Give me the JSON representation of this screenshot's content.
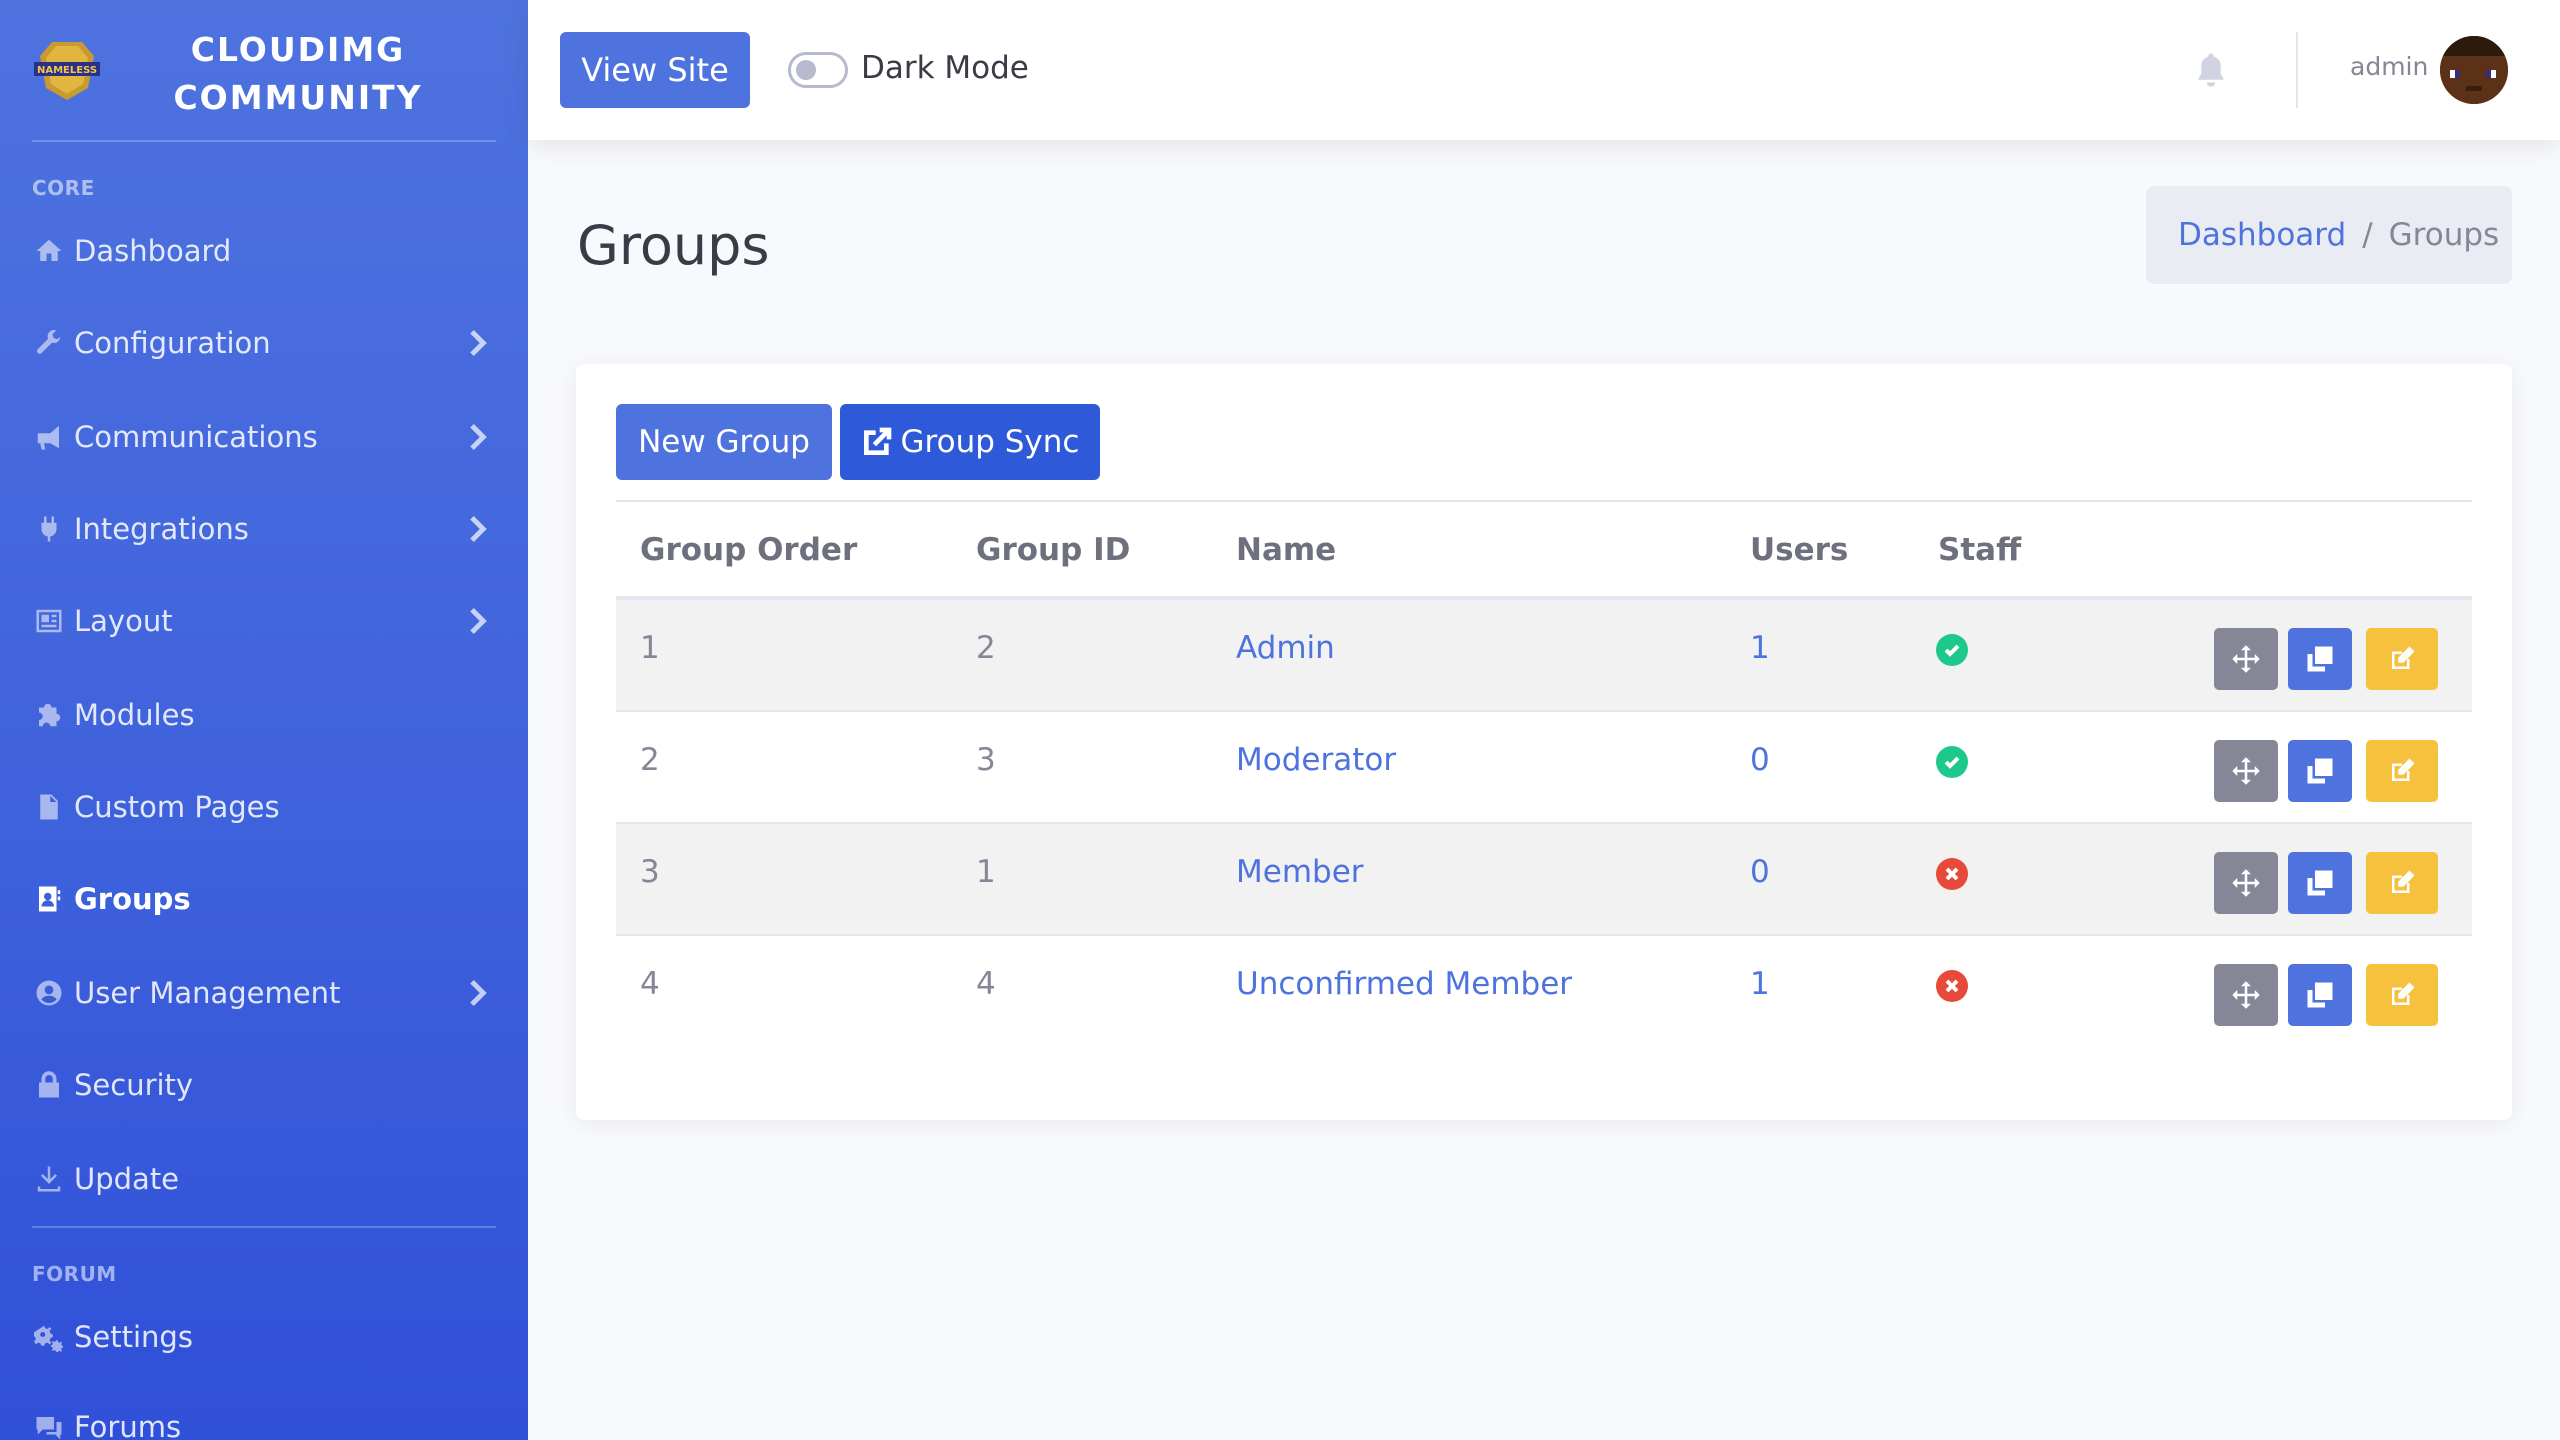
{
  "brand": {
    "name": "CLOUDIMG COMMUNITY",
    "logo_text": "NAMELESS"
  },
  "sidebar": {
    "heading_core": "CORE",
    "heading_forum": "FORUM",
    "items": [
      {
        "label": "Dashboard",
        "icon": "home-icon"
      },
      {
        "label": "Configuration",
        "icon": "wrench-icon"
      },
      {
        "label": "Communications",
        "icon": "bullhorn-icon"
      },
      {
        "label": "Integrations",
        "icon": "plug-icon"
      },
      {
        "label": "Layout",
        "icon": "layout-icon"
      },
      {
        "label": "Modules",
        "icon": "puzzle-icon"
      },
      {
        "label": "Custom Pages",
        "icon": "file-icon"
      },
      {
        "label": "Groups",
        "icon": "address-card-icon"
      },
      {
        "label": "User Management",
        "icon": "user-circle-icon"
      },
      {
        "label": "Security",
        "icon": "lock-icon"
      },
      {
        "label": "Update",
        "icon": "download-icon"
      },
      {
        "label": "Settings",
        "icon": "cogs-icon"
      },
      {
        "label": "Forums",
        "icon": "comments-icon"
      }
    ]
  },
  "topbar": {
    "view_site": "View Site",
    "dark_mode_label": "Dark Mode",
    "username": "admin"
  },
  "page": {
    "title": "Groups",
    "breadcrumb": {
      "parent": "Dashboard",
      "separator": "/",
      "current": "Groups"
    }
  },
  "actions": {
    "new_group": "New Group",
    "group_sync": "Group Sync"
  },
  "table": {
    "headers": [
      "Group Order",
      "Group ID",
      "Name",
      "Users",
      "Staff"
    ],
    "rows": [
      {
        "order": "1",
        "id": "2",
        "name": "Admin",
        "users": "1",
        "staff": true
      },
      {
        "order": "2",
        "id": "3",
        "name": "Moderator",
        "users": "0",
        "staff": true
      },
      {
        "order": "3",
        "id": "1",
        "name": "Member",
        "users": "0",
        "staff": false
      },
      {
        "order": "4",
        "id": "4",
        "name": "Unconfirmed Member",
        "users": "1",
        "staff": false
      }
    ]
  },
  "colors": {
    "primary": "#4e73df",
    "success": "#1cc88a",
    "danger": "#e74a3b",
    "warning": "#f6c23e",
    "secondary": "#858796"
  }
}
